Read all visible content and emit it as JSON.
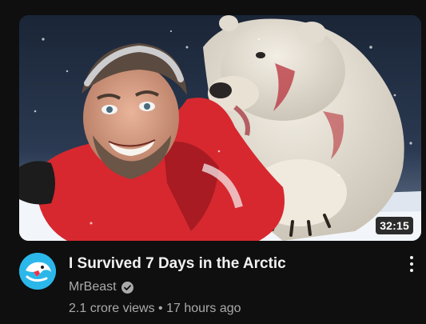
{
  "video": {
    "duration": "32:15",
    "title": "I Survived 7 Days in the Arctic",
    "channel": "MrBeast",
    "views": "2.1 crore views",
    "separator": "•",
    "age": "17 hours ago"
  },
  "icons": {
    "verified": "verified-check-icon",
    "more": "more-vert-icon",
    "avatar": "mrbeast-logo"
  },
  "colors": {
    "background": "#0f0f0f",
    "title": "#f1f1f1",
    "secondary": "#aaaaaa",
    "avatar_bg": "#2bb7ea"
  }
}
